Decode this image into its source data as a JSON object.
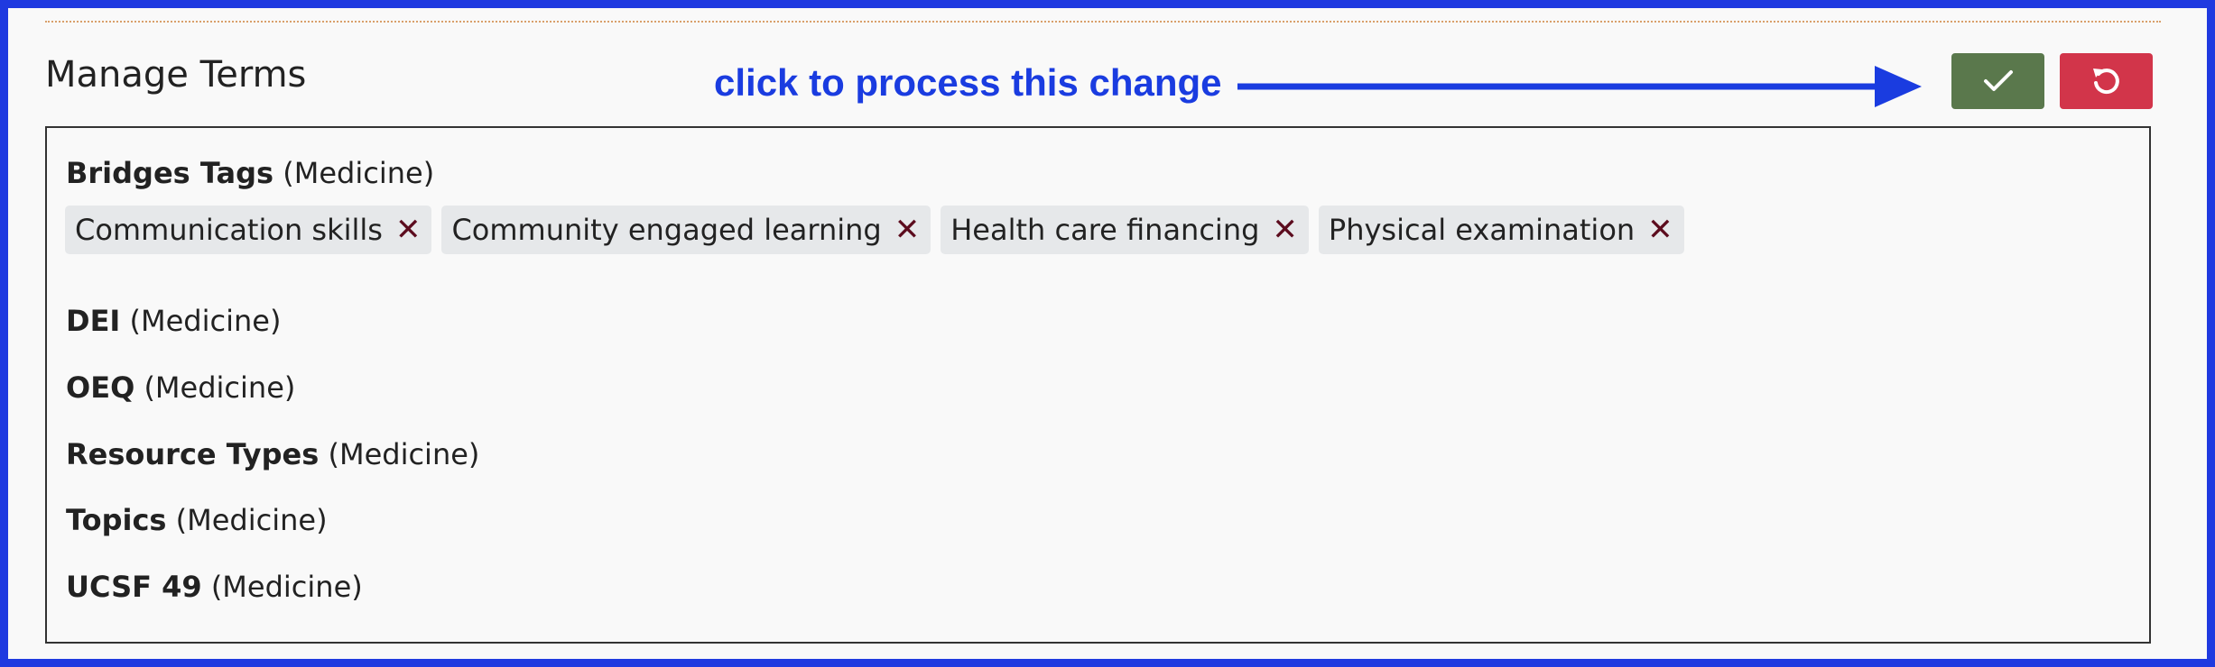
{
  "header": {
    "title": "Manage Terms",
    "annotation": "click to process this change"
  },
  "actions": {
    "confirm_icon": "check-icon",
    "revert_icon": "undo-icon"
  },
  "vocabularies": [
    {
      "name": "Bridges Tags",
      "school": "(Medicine)",
      "tags": [
        "Communication skills",
        "Community engaged learning",
        "Health care financing",
        "Physical examination"
      ],
      "remove_glyph": "✕"
    },
    {
      "name": "DEI",
      "school": "(Medicine)"
    },
    {
      "name": "OEQ",
      "school": "(Medicine)"
    },
    {
      "name": "Resource Types",
      "school": "(Medicine)"
    },
    {
      "name": "Topics",
      "school": "(Medicine)"
    },
    {
      "name": "UCSF 49",
      "school": "(Medicine)"
    }
  ],
  "colors": {
    "frame_border": "#1f3ae0",
    "annotation": "#1a3ce0",
    "confirm_button": "#5a784c",
    "revert_button": "#d2354a",
    "tag_background": "#e6e8ea",
    "tag_remove": "#5c0c1e"
  }
}
